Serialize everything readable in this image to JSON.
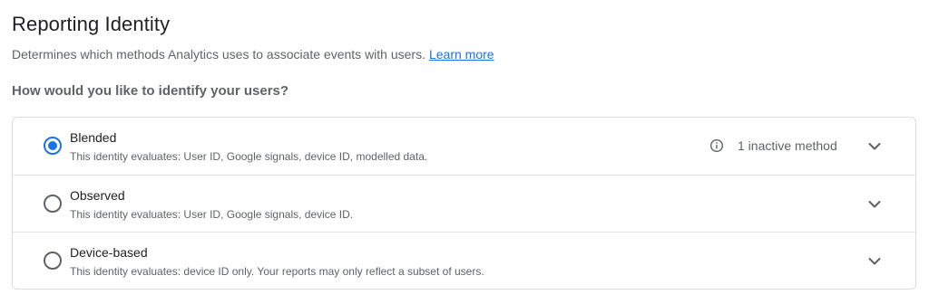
{
  "header": {
    "title": "Reporting Identity",
    "description": "Determines which methods Analytics uses to associate events with users.",
    "learn_more": "Learn more"
  },
  "question": "How would you like to identify your users?",
  "options": [
    {
      "label": "Blended",
      "description": "This identity evaluates: User ID, Google signals, device ID, modelled data.",
      "selected": true,
      "status_text": "1 inactive method",
      "status_icon": "info-icon"
    },
    {
      "label": "Observed",
      "description": "This identity evaluates: User ID, Google signals, device ID.",
      "selected": false
    },
    {
      "label": "Device-based",
      "description": "This identity evaluates: device ID only. Your reports may only reflect a subset of users.",
      "selected": false
    }
  ],
  "colors": {
    "accent": "#1a73e8",
    "text_primary": "#202124",
    "text_secondary": "#5f6368",
    "border": "#dadce0"
  }
}
